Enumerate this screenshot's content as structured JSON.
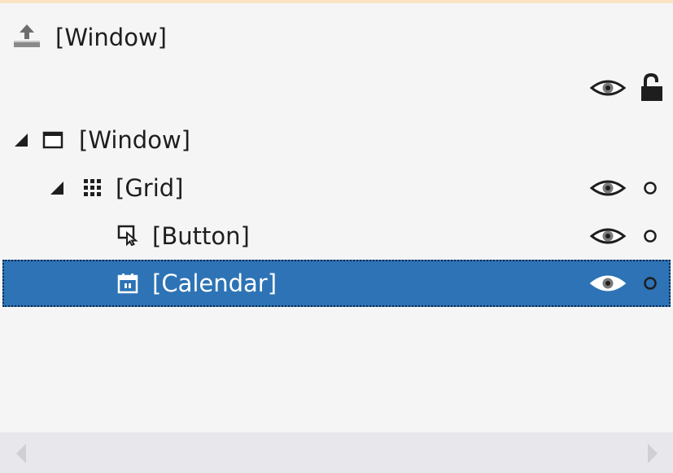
{
  "scope": {
    "label": "[Window]",
    "icon": "scope-up-icon"
  },
  "scope_controls": {
    "visibility_icon": "eye-icon",
    "lock_icon": "unlocked-padlock-icon"
  },
  "tree": [
    {
      "label": "[Window]",
      "icon": "window-icon",
      "expanded": true,
      "depth": 0,
      "controls": false
    },
    {
      "label": "[Grid]",
      "icon": "grid-icon",
      "expanded": true,
      "depth": 1,
      "controls": true
    },
    {
      "label": "[Button]",
      "icon": "button-icon",
      "expanded": false,
      "depth": 2,
      "controls": true
    },
    {
      "label": "[Calendar]",
      "icon": "calendar-icon",
      "expanded": false,
      "depth": 2,
      "controls": true,
      "selected": true
    }
  ],
  "colors": {
    "selection": "#2d73b5",
    "background": "#f5f5f6",
    "text": "#1e1e1e",
    "accent_border": "#fbe3c4"
  }
}
